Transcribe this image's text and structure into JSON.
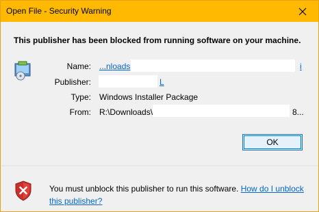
{
  "window": {
    "title": "Open File - Security Warning"
  },
  "headline": "This publisher has been blocked from running software on your machine.",
  "details": {
    "name_label": "Name:",
    "name_value": "...nloads",
    "name_tail": "i",
    "publisher_label": "Publisher:",
    "publisher_tail": "L",
    "type_label": "Type:",
    "type_value": "Windows Installer Package",
    "from_label": "From:",
    "from_value": "R:\\Downloads\\",
    "from_tail": "8..."
  },
  "buttons": {
    "ok": "OK"
  },
  "footer": {
    "message": "You must unblock this publisher to run this software.",
    "help_link": "How do I unblock this publisher?"
  },
  "icons": {
    "close": "close-icon",
    "package": "installer-package-icon",
    "shield": "shield-error-icon"
  },
  "colors": {
    "titlebar": "#ffb900",
    "link": "#0066cc",
    "button_border": "#0078d7"
  }
}
